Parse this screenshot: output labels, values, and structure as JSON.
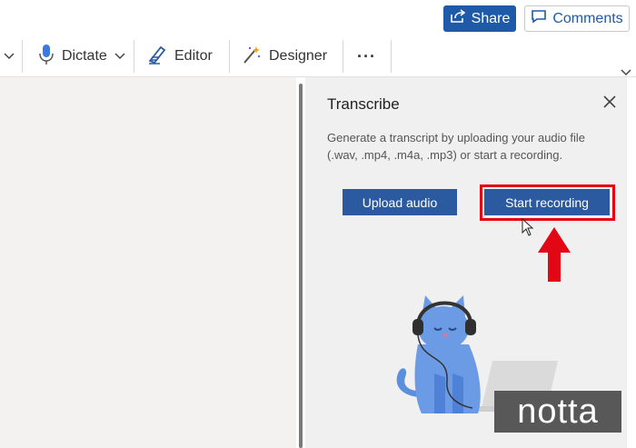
{
  "topbar": {
    "share_label": "Share",
    "comments_label": "Comments"
  },
  "ribbon": {
    "dictate_label": "Dictate",
    "editor_label": "Editor",
    "designer_label": "Designer",
    "more_label": "···"
  },
  "pane": {
    "title": "Transcribe",
    "description": "Generate a transcript by uploading your audio file (.wav, .mp4, .m4a, .mp3) or start a recording.",
    "upload_label": "Upload audio",
    "record_label": "Start recording"
  },
  "watermark": {
    "text": "notta"
  },
  "colors": {
    "accent_blue": "#1e5aa8",
    "button_blue": "#2c5aa0",
    "highlight_red": "#e30613",
    "cat_blue": "#5b8fde"
  }
}
